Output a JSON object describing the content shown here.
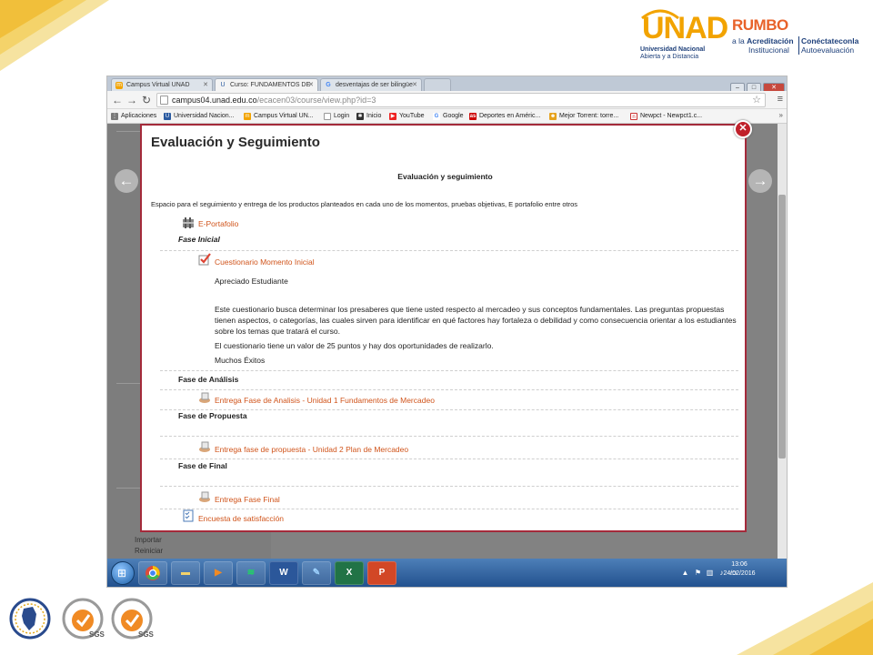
{
  "brand": {
    "unad_name": "UNAD",
    "unad_line1": "Universidad Nacional",
    "unad_line2": "Abierta y a Distancia",
    "rumbo_word": "RUMBO",
    "rumbo_line1_pre": "a la ",
    "rumbo_line1_bold": "Acreditación",
    "rumbo_line2": "Institucional",
    "conectate_line1": "Conéctateconla",
    "conectate_line2": "Autoevaluación",
    "accent": "#a42a3a",
    "link_color": "#d0541b"
  },
  "browser": {
    "tabs": [
      {
        "label": "Campus Virtual UNAD",
        "icon": "unad-favicon"
      },
      {
        "label": "Curso: FUNDAMENTOS DE",
        "icon": "course-favicon"
      },
      {
        "label": "desventajas de ser bilingüe",
        "icon": "google-favicon"
      }
    ],
    "url_host": "campus04.unad.edu.co",
    "url_path": "/ecacen03/course/view.php?id=3",
    "bookmarks": [
      {
        "label": "Aplicaciones",
        "icon": "apps-icon"
      },
      {
        "label": "Universidad Nacion...",
        "icon": "unad-favicon"
      },
      {
        "label": "Campus Virtual UN...",
        "icon": "campus-favicon"
      },
      {
        "label": "Login",
        "icon": "page-icon"
      },
      {
        "label": "Inicio",
        "icon": "inicio-icon"
      },
      {
        "label": "YouTube",
        "icon": "youtube-icon"
      },
      {
        "label": "Google",
        "icon": "google-icon"
      },
      {
        "label": "Deportes en Améric...",
        "icon": "as-icon"
      },
      {
        "label": "Mejor Torrent: torre...",
        "icon": "torrent-icon"
      },
      {
        "label": "Newpct - Newpct1.c...",
        "icon": "newpct-icon"
      }
    ]
  },
  "background_page": {
    "left_labels": [
      "Importar",
      "Reiniciar"
    ]
  },
  "taskbar": {
    "time": "13:06",
    "date": "24/02/2016"
  },
  "modal": {
    "title": "Evaluación y Seguimiento",
    "subtitle": "Evaluación y seguimiento",
    "description": "Espacio para el seguimiento y entrega de los productos planteados en cada uno de los momentos, pruebas objetivas,  E portafolio  entre otros",
    "eportafolio": "E-Portafolio",
    "fase_inicial": "Fase Inicial",
    "cuestionario": "Cuestionario Momento Inicial",
    "apreciado": "Apreciado Estudiante",
    "paragraph": "Este cuestionario busca determinar los presaberes que tiene usted respecto al mercadeo y sus conceptos fundamentales. Las preguntas propuestas tienen aspectos, o categorías, las cuales sirven para identificar en qué factores hay fortaleza o debilidad y como consecuencia orientar a los estudiantes sobre los temas que tratará el curso.",
    "valor": "El cuestionario tiene un valor de 25 puntos y hay dos oportunidades de realizarlo.",
    "exitos": "Muchos Éxitos",
    "fase_analisis": "Fase de Análisis",
    "entrega_analisis": "Entrega Fase de Analisis - Unidad 1 Fundamentos de Mercadeo",
    "fase_propuesta": "Fase de Propuesta",
    "entrega_propuesta": "Entrega fase de propuesta - Unidad 2 Plan de Mercadeo",
    "fase_final": "Fase de Final",
    "entrega_final": "Entrega Fase Final",
    "encuesta": "Encuesta de satisfacción"
  }
}
